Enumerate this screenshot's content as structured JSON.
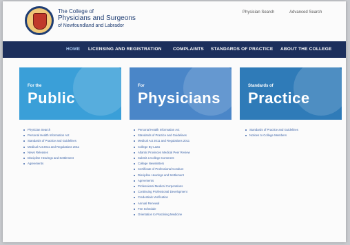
{
  "header": {
    "org_line1": "The College of",
    "org_line2": "Physicians and Surgeons",
    "org_line3": "of Newfoundland and Labrador",
    "util_links": [
      "Physician Search",
      "Advanced Search"
    ]
  },
  "nav": {
    "items": [
      "HOME",
      "LICENSING AND REGISTRATION",
      "COMPLAINTS",
      "STANDARDS OF PRACTICE",
      "ABOUT THE COLLEGE"
    ],
    "active": "HOME"
  },
  "tiles": [
    {
      "small": "For the",
      "big": "Public",
      "color": "#3a9fd8"
    },
    {
      "small": "For",
      "big": "Physicians",
      "color": "#4a86c8"
    },
    {
      "small": "Standards of",
      "big": "Practice",
      "color": "#2f7bb8"
    }
  ],
  "lists": {
    "public": [
      "Physician Search",
      "Personal Health Information Act",
      "Standards of Practice and Guidelines",
      "Medical Act 2011 and Regulations 2011",
      "News Releases",
      "Discipline Hearings and Settlement",
      "Agreements"
    ],
    "physicians": [
      "Personal Health Information Act",
      "Standards of Practice and Guidelines",
      "Medical Act 2011 and Regulations 2011",
      "College By-Laws",
      "Atlantic Provinces Medical Peer Review",
      "Submit a College Comment",
      "College Newsletters",
      "Certificate of Professional Conduct",
      "Discipline Hearings and Settlement",
      "Agreements",
      "Professional Medical Corporations",
      "Continuing Professional Development",
      "Credentials Verification",
      "Annual Renewal",
      "Fee Schedule",
      "Orientation to Practising Medicine"
    ],
    "practice": [
      "Standards of Practice and Guidelines",
      "Notices to College Members"
    ]
  }
}
